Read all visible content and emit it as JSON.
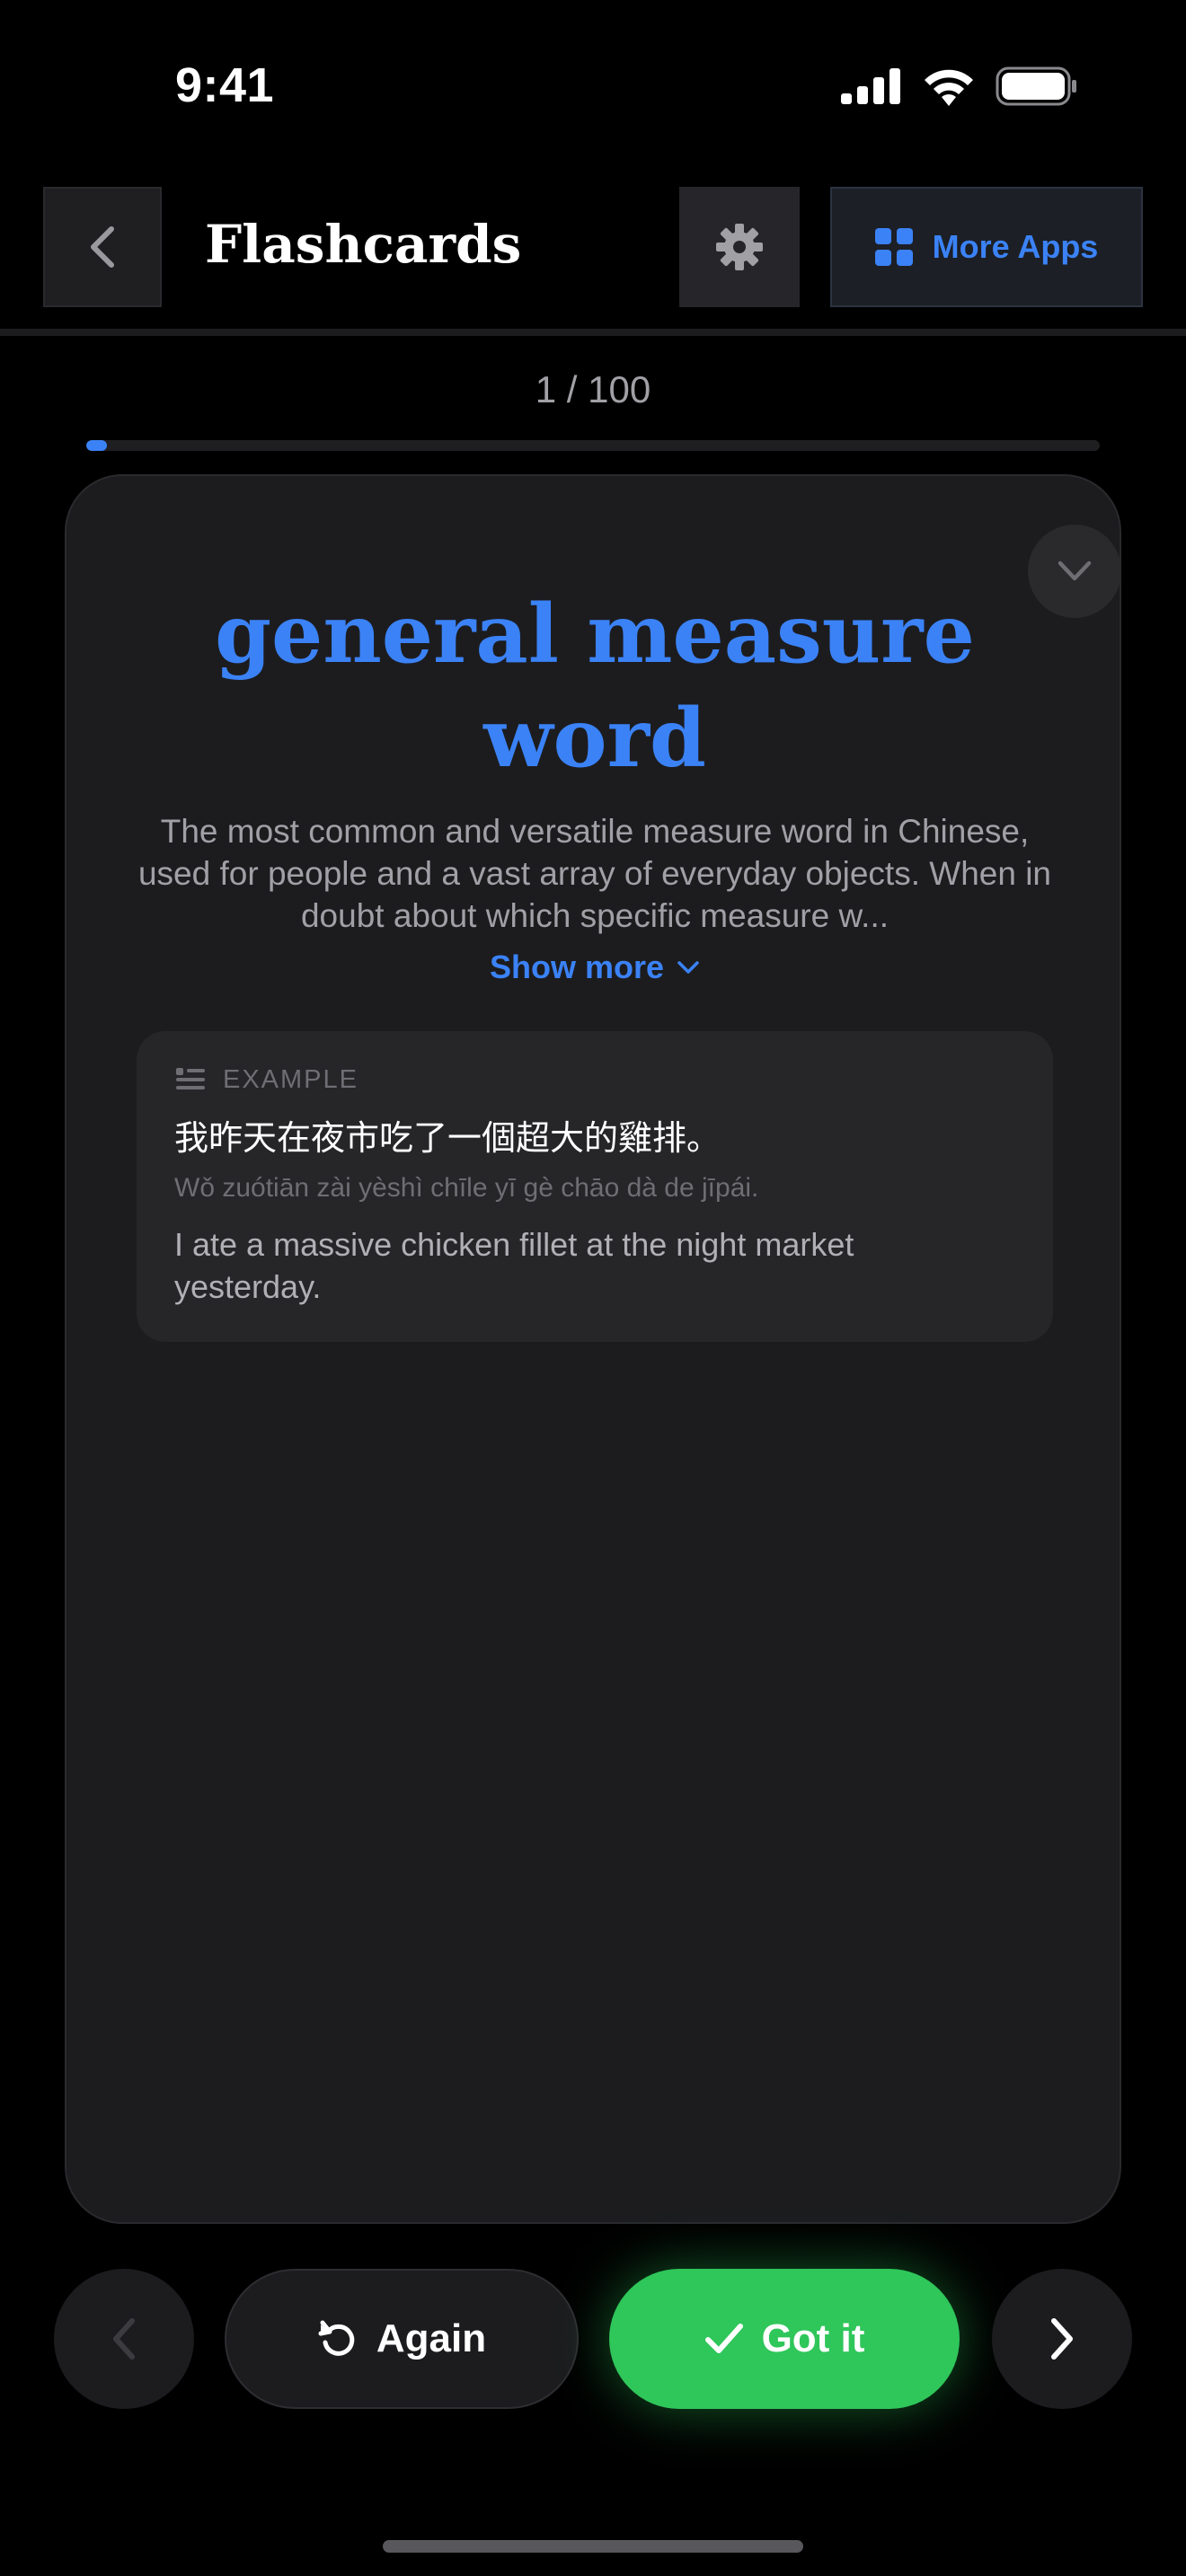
{
  "status": {
    "time": "9:41"
  },
  "header": {
    "title": "Flashcards",
    "more_apps_label": "More Apps"
  },
  "progress": {
    "text": "1 / 100",
    "current": 1,
    "total": 100
  },
  "card": {
    "word": "general measure word",
    "definition": "The most common and versatile measure word in Chinese, used for people and a vast array of everyday objects. When in doubt about which specific measure w...",
    "show_more_label": "Show more",
    "example": {
      "label": "EXAMPLE",
      "hanzi": "我昨天在夜市吃了一個超大的雞排。",
      "pinyin": "Wǒ zuótiān zài yèshì chīle yī gè chāo dà de jīpái.",
      "translation": "I ate a massive chicken fillet at the night market yesterday."
    }
  },
  "controls": {
    "again_label": "Again",
    "gotit_label": "Got it"
  },
  "colors": {
    "accent": "#3b82f6",
    "success": "#2fc65a",
    "background": "#000000",
    "card": "#1c1c1f"
  }
}
